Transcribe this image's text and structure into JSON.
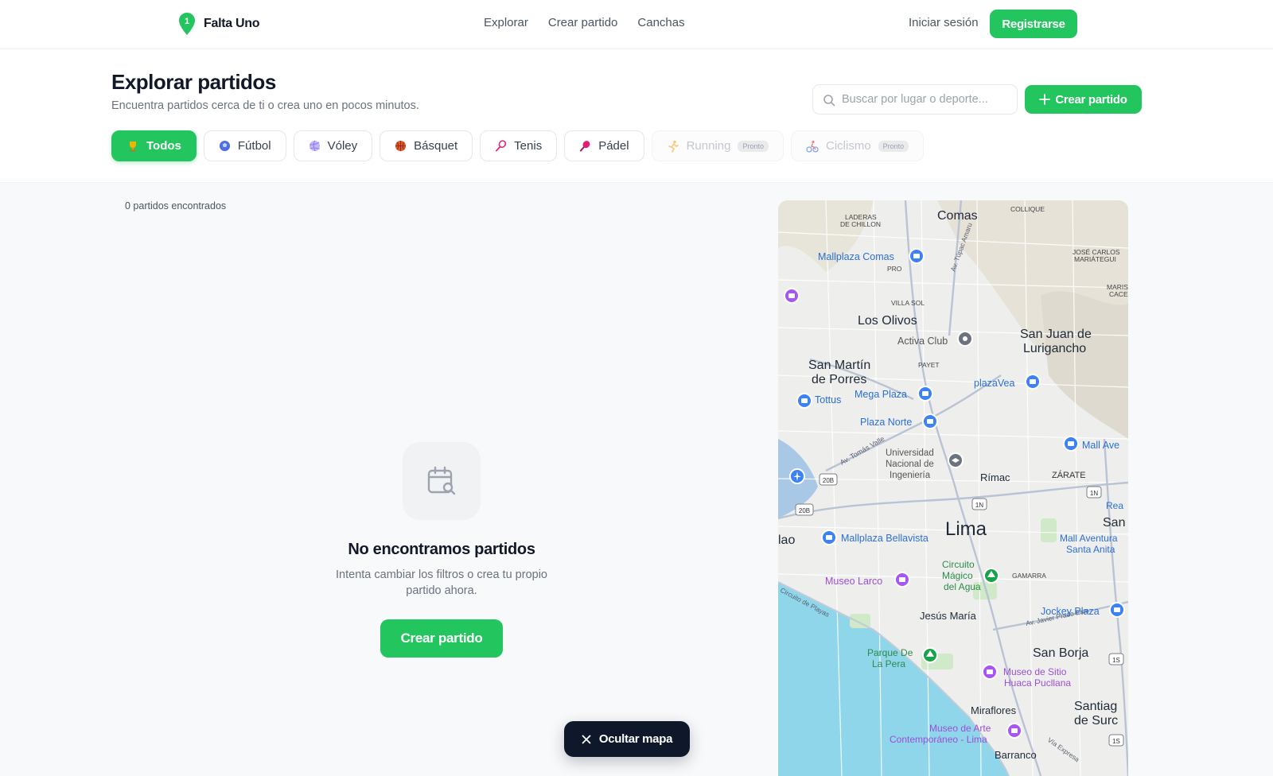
{
  "app": {
    "name": "Falta Uno",
    "accent": "#22c55e",
    "dark": "#0f172a"
  },
  "nav": {
    "links": [
      "Explorar",
      "Crear partido",
      "Canchas"
    ],
    "login": "Iniciar sesión",
    "register": "Registrarse"
  },
  "header": {
    "title": "Explorar partidos",
    "subtitle": "Encuentra partidos cerca de ti o crea uno en pocos minutos.",
    "search_placeholder": "Buscar por lugar o deporte...",
    "create_label": "Crear partido"
  },
  "filters": [
    {
      "label": "Todos",
      "icon": "trophy-icon",
      "active": true,
      "disabled": false,
      "badge": ""
    },
    {
      "label": "Fútbol",
      "icon": "soccer-ball-icon",
      "active": false,
      "disabled": false,
      "badge": ""
    },
    {
      "label": "Vóley",
      "icon": "volleyball-icon",
      "active": false,
      "disabled": false,
      "badge": ""
    },
    {
      "label": "Básquet",
      "icon": "basketball-icon",
      "active": false,
      "disabled": false,
      "badge": ""
    },
    {
      "label": "Tenis",
      "icon": "tennis-racket-icon",
      "active": false,
      "disabled": false,
      "badge": ""
    },
    {
      "label": "Pádel",
      "icon": "padel-icon",
      "active": false,
      "disabled": false,
      "badge": ""
    },
    {
      "label": "Running",
      "icon": "runner-icon",
      "active": false,
      "disabled": true,
      "badge": "Pronto"
    },
    {
      "label": "Ciclismo",
      "icon": "cyclist-icon",
      "active": false,
      "disabled": true,
      "badge": "Pronto"
    }
  ],
  "results": {
    "count_text": "0 partidos encontrados"
  },
  "empty_state": {
    "icon": "calendar-search-icon",
    "title": "No encontramos partidos",
    "text": "Intenta cambiar los filtros o crea tu propio partido ahora.",
    "button": "Crear partido"
  },
  "map": {
    "labels": {
      "comas": "Comas",
      "collique": "COLLIQUE",
      "laderas": "LADERAS",
      "chillon": "DE CHILLON",
      "mallplaza_comas": "Mallplaza Comas",
      "pro": "PRO",
      "jose_carlos": "JOSÉ CARLOS",
      "mariategui": "MARIÁTEGUI",
      "marisc": "MARISC",
      "cacere": "CACERE",
      "villa_sol": "VILLA SOL",
      "los_olivos": "Los Olivos",
      "activa_club": "Activa Club",
      "sjl1": "San Juan de",
      "sjl2": "Lurigancho",
      "payet": "PAYET",
      "smp1": "San Martín",
      "smp2": "de Porres",
      "mega_plaza": "Mega Plaza",
      "plazavea": "plazaVea",
      "tottus": "Tottus",
      "plaza_norte": "Plaza Norte",
      "mall_ave": "Mall Ave",
      "univ1": "Universidad",
      "univ2": "Nacional de",
      "univ3": "Ingeniería",
      "zarate": "ZÁRATE",
      "rimac": "Rímac",
      "av_tomas": "Av. Tomás Valle",
      "av_tupac": "Av. Túpac Amaru",
      "lima": "Lima",
      "rea": "Rea",
      "san": "San",
      "callao": "lao",
      "mallplaza_bellavista": "Mallplaza Bellavista",
      "mall_aventura1": "Mall Aventura",
      "mall_aventura2": "Santa Anita",
      "circuito1": "Circuito",
      "circuito2": "Mágico",
      "circuito3": "del Agua",
      "gamarra": "GAMARRA",
      "museo_larco": "Museo Larco",
      "circuito_playas": "Circuito de Playas",
      "jesus_maria": "Jesús María",
      "jockey": "Jockey Plaza",
      "av_javier": "Av. Javier Prado Este",
      "parque1": "Parque De",
      "parque2": "La Pera",
      "san_borja": "San Borja",
      "huaca1": "Museo de Sitio",
      "huaca2": "Huaca Pucllana",
      "santiago1": "Santiag",
      "santiago2": "de Surc",
      "miraflores": "Miraflores",
      "mac1": "Museo de Arte",
      "mac2": "Contemporáneo - Lima",
      "barranco": "Barranco",
      "via_expresa": "Vía Expresa",
      "r20b": "20B",
      "r1n": "1N",
      "r1s": "1S",
      "r1s_b": "1S"
    }
  },
  "hide_map": {
    "label": "Ocultar mapa"
  }
}
